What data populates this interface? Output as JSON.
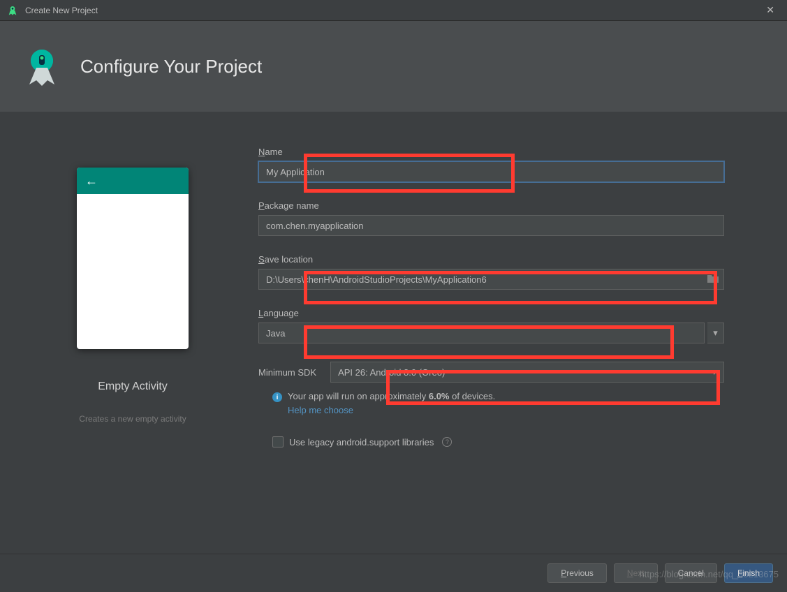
{
  "window": {
    "title": "Create New Project",
    "heading": "Configure Your Project"
  },
  "preview": {
    "title": "Empty Activity",
    "subtitle": "Creates a new empty activity"
  },
  "form": {
    "name": {
      "label": "Name",
      "value": "My Application"
    },
    "package": {
      "label": "Package name",
      "value": "com.chen.myapplication"
    },
    "save_location": {
      "label": "Save location",
      "value": "D:\\Users\\chenH\\AndroidStudioProjects\\MyApplication6"
    },
    "language": {
      "label": "Language",
      "value": "Java"
    },
    "min_sdk": {
      "label": "Minimum SDK",
      "value": "API 26: Android 8.0 (Oreo)"
    },
    "info": {
      "prefix": "Your app will run on approximately ",
      "pct": "6.0%",
      "suffix": " of devices."
    },
    "help_link": "Help me choose",
    "legacy": {
      "label": "Use legacy android.support libraries"
    }
  },
  "footer": {
    "previous": "Previous",
    "next": "Next",
    "cancel": "Cancel",
    "finish": "Finish"
  },
  "watermark": "https://blog.csdn.net/qq_38213675"
}
